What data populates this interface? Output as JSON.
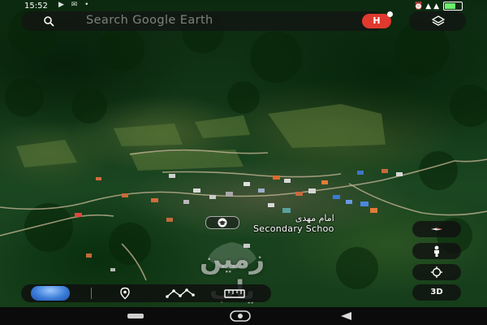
{
  "status_bar": {
    "time": "15:52",
    "left_icons": "▶ ✉ •",
    "right_icons": "⏰ ▲ ▲"
  },
  "search": {
    "placeholder": "Search Google Earth",
    "avatar_letter": "H",
    "avatar_color": "#e0392e"
  },
  "place": {
    "name_fa": "امام مهدی",
    "name_en": "Secondary Schoo",
    "icon": "school-icon"
  },
  "controls": {
    "compass": "compass-icon",
    "pegman": "pegman-icon",
    "locate": "locate-icon",
    "mode_3d_label": "3D"
  },
  "toolbar": {
    "globe": "voyager-globe-icon",
    "place": "place-pin-icon",
    "path": "draw-path-icon",
    "measure": "ruler-icon"
  },
  "watermark": {
    "text": "زمین یاب"
  },
  "nav_bar": {
    "recents": "recents-icon",
    "home": "home-icon",
    "back": "back-icon"
  }
}
